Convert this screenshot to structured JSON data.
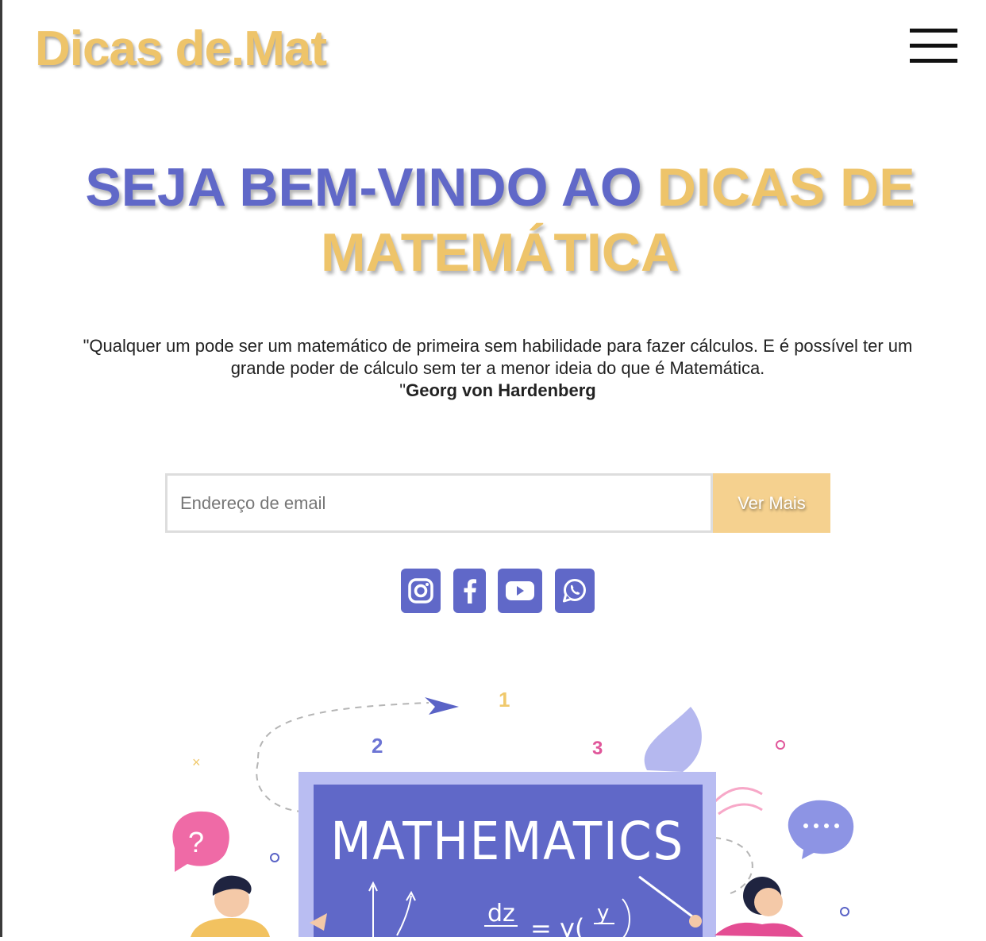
{
  "header": {
    "logo": "Dicas de.Mat",
    "menu_icon": "hamburger-menu-icon"
  },
  "hero": {
    "title_part1": "SEJA BEM-VINDO AO ",
    "title_part2": "DICAS DE MATEMÁTICA"
  },
  "quote": {
    "line1": "\"Qualquer um pode ser um matemático de primeira sem habilidade para fazer cálculos. E é possível ter um",
    "line2": "grande poder de cálculo sem ter a menor ideia do que é Matemática.",
    "open_mark": "\"",
    "author": "Georg von Hardenberg"
  },
  "form": {
    "email_placeholder": "Endereço de email",
    "email_value": "",
    "button_label": "Ver Mais"
  },
  "socials": [
    {
      "icon": "instagram-icon"
    },
    {
      "icon": "facebook-icon"
    },
    {
      "icon": "youtube-icon"
    },
    {
      "icon": "whatsapp-icon"
    }
  ],
  "illustration": {
    "board_text": "MATHEMATICS",
    "numbers": [
      "1",
      "2",
      "3"
    ],
    "equation_left": "dz",
    "equation_right": "= y(",
    "equation_frac": "y"
  },
  "colors": {
    "brand_gold": "#eec46a",
    "brand_blue": "#6068c8",
    "button_bg": "#f5d18f"
  }
}
